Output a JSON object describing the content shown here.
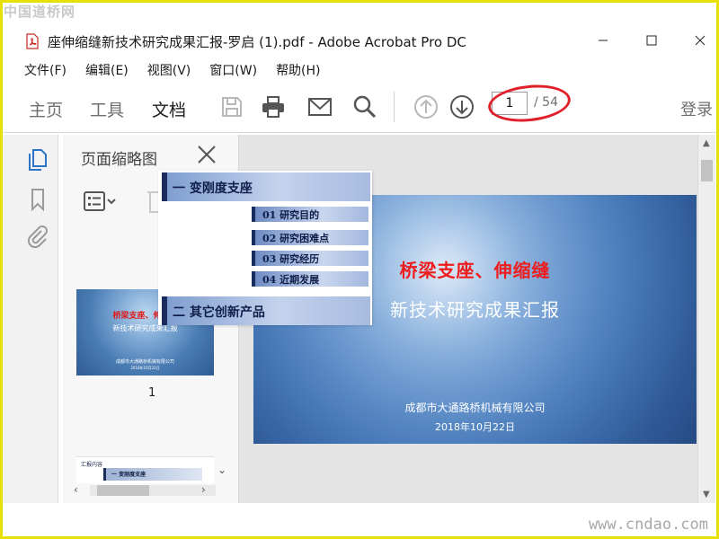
{
  "watermark": {
    "top_left": "中国道桥网",
    "bottom_right": "www.cndao.com"
  },
  "window": {
    "title": "座伸缩缝新技术研究成果汇报-罗启 (1).pdf - Adobe Acrobat Pro DC"
  },
  "menu": {
    "items": [
      "文件(F)",
      "编辑(E)",
      "视图(V)",
      "窗口(W)",
      "帮助(H)"
    ]
  },
  "toolbar": {
    "tabs": [
      "主页",
      "工具",
      "文档"
    ],
    "active_tab": "文档",
    "icons": [
      "save-icon",
      "print-icon",
      "email-icon",
      "search-icon",
      "page-up-icon",
      "page-down-icon"
    ],
    "page_current": "1",
    "page_total": "/ 54",
    "login": "登录"
  },
  "thumbnail_panel": {
    "title": "页面缩略图",
    "thumb1": {
      "title": "桥梁支座、伸缩缝",
      "subtitle": "新技术研究成果汇报",
      "company": "成都市大通路桥机械有限公司",
      "date": "2018年10月22日",
      "page_number": "1"
    },
    "thumb2": {
      "label": "汇报内容",
      "bar": "一 变刚度支座"
    }
  },
  "slide": {
    "title": "桥梁支座、伸缩缝",
    "subtitle": "新技术研究成果汇报",
    "company": "成都市大通路桥机械有限公司",
    "date": "2018年10月22日"
  },
  "popup": {
    "heading1": "一 变刚度支座",
    "items": [
      "01  研究目的",
      "02  研究困难点",
      "03  研究经历",
      "04  近期发展"
    ],
    "heading2": "二 其它创新产品"
  },
  "colors": {
    "accent_red": "#e0212b",
    "slide_title": "#ee1c1c",
    "frame": "#e8e000"
  }
}
